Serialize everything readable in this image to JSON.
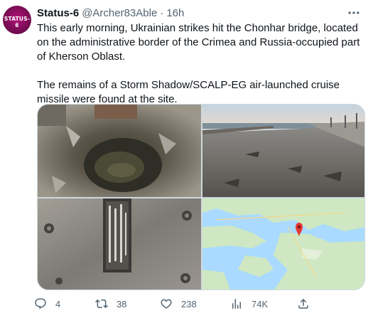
{
  "tweet": {
    "avatar_text": "STATUS-6",
    "display_name": "Status-6",
    "handle": "@Archer83Able",
    "separator": "·",
    "time": "16h",
    "paragraphs": [
      "This early morning, Ukrainian strikes hit the Chonhar bridge, located on the administrative border of the Crimea and Russia-occupied part of Kherson Oblast.",
      "The remains of a Storm Shadow/SCALP-EG air-launched cruise missile were found at the site."
    ]
  },
  "media": {
    "images": [
      {
        "icon": "crater-photo"
      },
      {
        "icon": "bridge-road-photo"
      },
      {
        "icon": "missile-fragment-photo"
      },
      {
        "icon": "map-photo"
      }
    ]
  },
  "actions": {
    "reply_count": "4",
    "retweet_count": "38",
    "like_count": "238",
    "views_count": "74K"
  },
  "colors": {
    "text": "#0f1419",
    "secondary": "#536471",
    "border": "#cfd9de",
    "map_pin": "#e53935"
  }
}
